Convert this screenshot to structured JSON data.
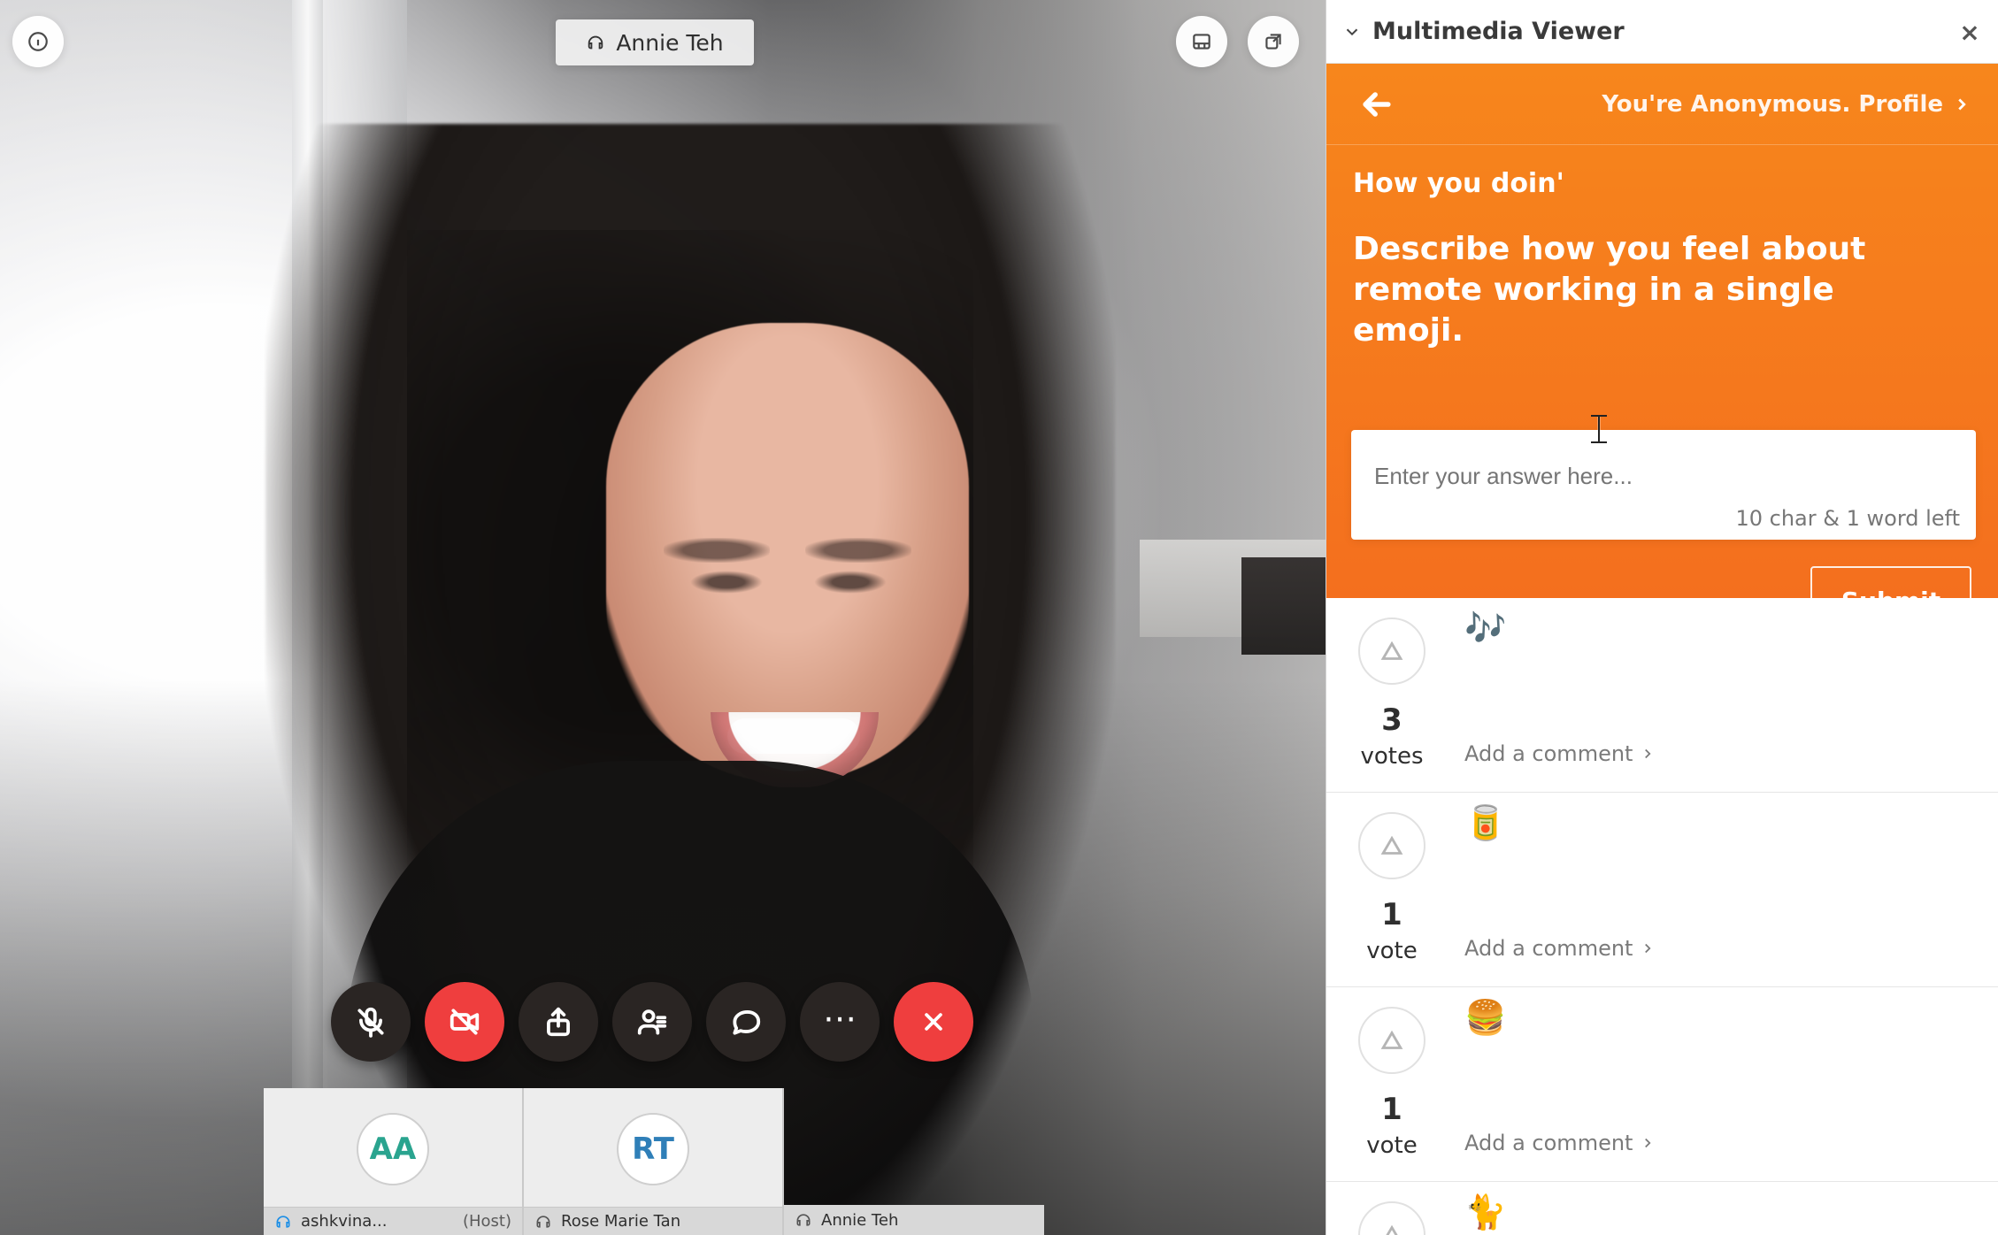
{
  "video": {
    "speaker": "Annie Teh"
  },
  "controls": {
    "items": [
      {
        "name": "mute",
        "icon": "mic-off-icon"
      },
      {
        "name": "stop-video",
        "icon": "video-off-icon"
      },
      {
        "name": "share",
        "icon": "share-icon"
      },
      {
        "name": "participants",
        "icon": "participants-icon"
      },
      {
        "name": "chat",
        "icon": "chat-icon"
      },
      {
        "name": "more",
        "icon": "more-icon"
      },
      {
        "name": "end",
        "icon": "close-icon"
      }
    ]
  },
  "participants": [
    {
      "initials": "AA",
      "name": "ashkvina...",
      "tag": "(Host)"
    },
    {
      "initials": "RT",
      "name": "Rose Marie Tan",
      "tag": ""
    },
    {
      "initials": "",
      "name": "Annie Teh",
      "tag": ""
    }
  ],
  "side_panel": {
    "title": "Multimedia Viewer",
    "top": {
      "profile_text": "You're Anonymous. Profile"
    },
    "question": {
      "title": "How you doin'",
      "text": "Describe how you feel about remote working in a single emoji."
    },
    "answer": {
      "placeholder": "Enter your answer here...",
      "counter": "10 char & 1 word left",
      "submit_label": "Submit"
    },
    "responses": [
      {
        "emoji": "🎶",
        "votes": "3",
        "unit": "votes",
        "comment_label": "Add a comment"
      },
      {
        "emoji": "🥫",
        "votes": "1",
        "unit": "vote",
        "comment_label": "Add a comment"
      },
      {
        "emoji": "🍔",
        "votes": "1",
        "unit": "vote",
        "comment_label": "Add a comment"
      },
      {
        "emoji": "🐈",
        "votes": "",
        "unit": "",
        "comment_label": ""
      }
    ]
  },
  "colors": {
    "accent": "#f46f1e",
    "danger": "#ef3e3e"
  }
}
